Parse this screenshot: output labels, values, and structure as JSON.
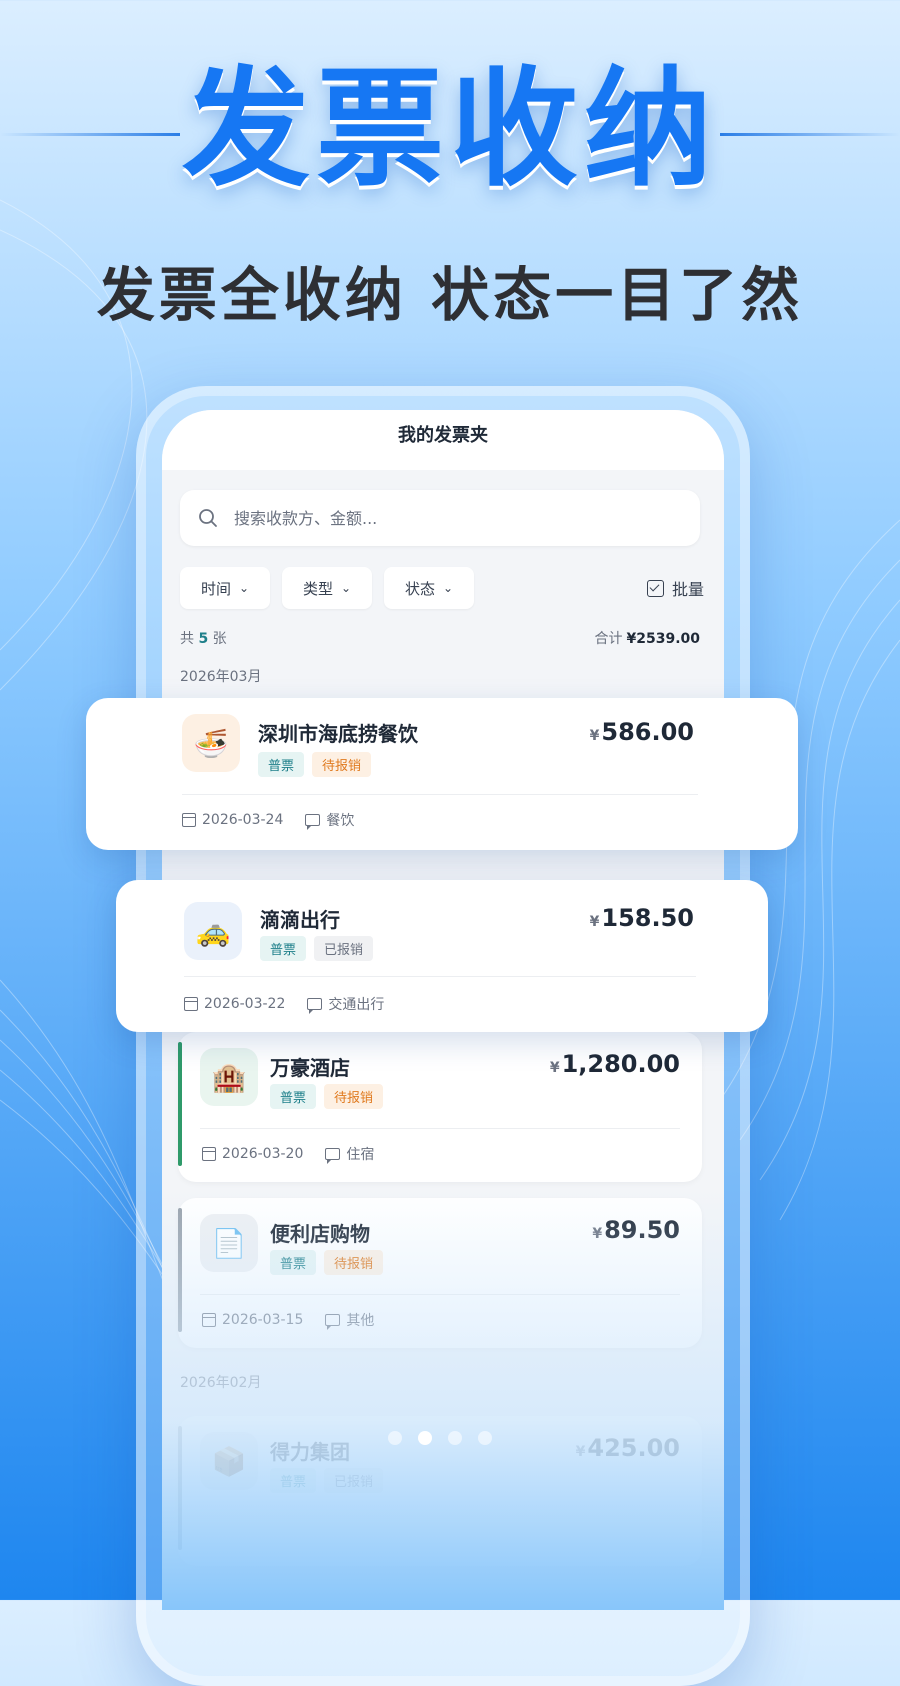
{
  "hero": {
    "title": "发票收纳",
    "subtitle": "发票全收纳  状态一目了然"
  },
  "app": {
    "header_title": "我的发票夹",
    "search_placeholder": "搜索收款方、金额...",
    "filters": [
      "时间",
      "类型",
      "状态"
    ],
    "batch_label": "批量",
    "summary": {
      "count_prefix": "共",
      "count": "5",
      "count_suffix": "张",
      "total_label": "合计",
      "total_value": "¥2539.00"
    },
    "months": [
      "2026年03月",
      "2026年02月"
    ],
    "invoices": [
      {
        "icon": "noodle-bowl-icon",
        "glyph": "🍜",
        "name": "深圳市海底捞餐饮",
        "type": "普票",
        "status": "待报销",
        "amount": "586.00",
        "date": "2026-03-24",
        "category": "餐饮"
      },
      {
        "icon": "taxi-icon",
        "glyph": "🚕",
        "name": "滴滴出行",
        "type": "普票",
        "status": "已报销",
        "amount": "158.50",
        "date": "2026-03-22",
        "category": "交通出行"
      },
      {
        "icon": "hotel-icon",
        "glyph": "🏨",
        "name": "万豪酒店",
        "type": "普票",
        "status": "待报销",
        "amount": "1,280.00",
        "date": "2026-03-20",
        "category": "住宿"
      },
      {
        "icon": "document-icon",
        "glyph": "📄",
        "name": "便利店购物",
        "type": "普票",
        "status": "待报销",
        "amount": "89.50",
        "date": "2026-03-15",
        "category": "其他"
      },
      {
        "icon": "box-icon",
        "glyph": "📦",
        "name": "得力集团",
        "type": "普票",
        "status": "已报销",
        "amount": "425.00"
      }
    ],
    "currency": "¥"
  },
  "pager": {
    "total": 4,
    "active_index": 1
  },
  "colors": {
    "brand_blue": "#1677f3",
    "teal": "#1e7f8a",
    "orange": "#e07a1f",
    "accent_green": "#2f9a6a"
  }
}
